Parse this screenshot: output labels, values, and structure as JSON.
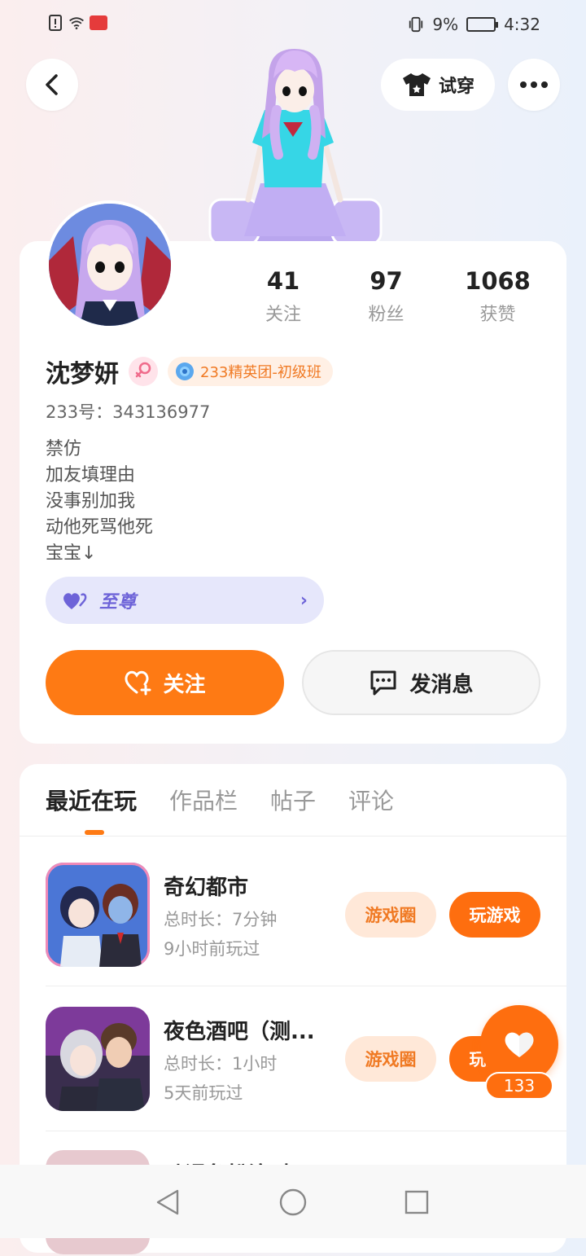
{
  "status_bar": {
    "battery_percent": "9%",
    "time": "4:32"
  },
  "header": {
    "try_on_label": "试穿"
  },
  "profile": {
    "stats": [
      {
        "value": "41",
        "label": "关注"
      },
      {
        "value": "97",
        "label": "粉丝"
      },
      {
        "value": "1068",
        "label": "获赞"
      }
    ],
    "name": "沈梦妍",
    "badge_text": "233精英团-初级班",
    "uid_label": "233号：",
    "uid_value": "343136977",
    "bio_lines": [
      "禁仿",
      "加友填理由",
      "没事别加我",
      "动他死骂他死",
      "宝宝↓"
    ],
    "vip_text": "至尊",
    "follow_label": "关注",
    "message_label": "发消息"
  },
  "tabs": [
    {
      "label": "最近在玩",
      "active": true
    },
    {
      "label": "作品栏",
      "active": false
    },
    {
      "label": "帖子",
      "active": false
    },
    {
      "label": "评论",
      "active": false
    }
  ],
  "games": [
    {
      "title": "奇幻都市",
      "duration": "总时长：7分钟",
      "last_played": "9小时前玩过",
      "circle_label": "游戏圈",
      "play_label": "玩游戏"
    },
    {
      "title": "夜色酒吧（测...",
      "duration": "总时长：1小时",
      "last_played": "5天前玩过",
      "circle_label": "游戏圈",
      "play_label": "玩游戏"
    },
    {
      "title": "动漫角扮演对..."
    }
  ],
  "fab": {
    "count": "133"
  },
  "colors": {
    "accent": "#fe7a14",
    "accent_light": "#ffe8d8",
    "vip_purple": "#6d63d8"
  }
}
